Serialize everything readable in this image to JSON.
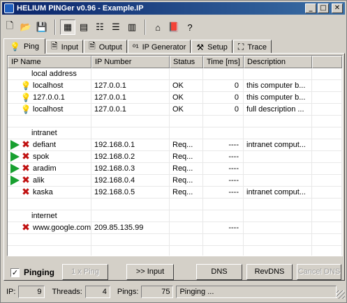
{
  "window": {
    "title": "HELIUM PINGer  v0.96  -  Example.IP",
    "controls": {
      "minimize": "_",
      "maximize": "□",
      "close": "✕"
    }
  },
  "toolbar": {
    "tools": [
      {
        "name": "new-file-icon",
        "glyph": "🗋"
      },
      {
        "name": "open-folder-icon",
        "glyph": "📂"
      },
      {
        "name": "save-icon",
        "glyph": "💾"
      },
      {
        "name": "large-icons-view-icon",
        "glyph": "▦"
      },
      {
        "name": "small-icons-view-icon",
        "glyph": "▤"
      },
      {
        "name": "list-view-icon",
        "glyph": "☷"
      },
      {
        "name": "details-view-icon",
        "glyph": "☰"
      },
      {
        "name": "grid-view-icon",
        "glyph": "▥"
      },
      {
        "name": "home-icon",
        "glyph": "⌂"
      },
      {
        "name": "book-icon",
        "glyph": "📕"
      },
      {
        "name": "help-icon",
        "glyph": "?"
      }
    ]
  },
  "tabs": [
    {
      "label": "Ping",
      "icon": "bulb-icon",
      "glyph": "💡",
      "active": true
    },
    {
      "label": "Input",
      "icon": "document-icon",
      "glyph": "🗎",
      "active": false
    },
    {
      "label": "Output",
      "icon": "document-icon",
      "glyph": "🗎",
      "active": false
    },
    {
      "label": "IP Generator",
      "icon": "binary-icon",
      "glyph": "⁰¹",
      "active": false
    },
    {
      "label": "Setup",
      "icon": "tools-icon",
      "glyph": "⚒",
      "active": false
    },
    {
      "label": "Trace",
      "icon": "trace-icon",
      "glyph": "⛶",
      "active": false
    }
  ],
  "table": {
    "columns": [
      "IP Name",
      "IP Number",
      "Status",
      "Time [ms]",
      "Description"
    ],
    "rows": [
      {
        "type": "group",
        "name": "local address"
      },
      {
        "type": "host",
        "icons": [
          "",
          "bulb"
        ],
        "name": "localhost",
        "ip": "127.0.0.1",
        "status": "OK",
        "time": "0",
        "desc": "this computer b..."
      },
      {
        "type": "host",
        "icons": [
          "",
          "bulb"
        ],
        "name": "127.0.0.1",
        "ip": "127.0.0.1",
        "status": "OK",
        "time": "0",
        "desc": "this computer b..."
      },
      {
        "type": "host",
        "icons": [
          "",
          "bulb"
        ],
        "name": "localhost",
        "ip": "127.0.0.1",
        "status": "OK",
        "time": "0",
        "desc": "full description ..."
      },
      {
        "type": "blank"
      },
      {
        "type": "group",
        "name": "intranet"
      },
      {
        "type": "host",
        "icons": [
          "arrow",
          "x"
        ],
        "name": "defiant",
        "ip": "192.168.0.1",
        "status": "Req...",
        "time": "----",
        "desc": " intranet comput..."
      },
      {
        "type": "host",
        "icons": [
          "arrow",
          "x"
        ],
        "name": "spok",
        "ip": "192.168.0.2",
        "status": "Req...",
        "time": "----",
        "desc": ""
      },
      {
        "type": "host",
        "icons": [
          "arrow",
          "x"
        ],
        "name": "aradim",
        "ip": "192.168.0.3",
        "status": "Req...",
        "time": "----",
        "desc": ""
      },
      {
        "type": "host",
        "icons": [
          "arrow",
          "x"
        ],
        "name": "alik",
        "ip": "192.168.0.4",
        "status": "Req...",
        "time": "----",
        "desc": ""
      },
      {
        "type": "host",
        "icons": [
          "",
          "x"
        ],
        "name": "kaska",
        "ip": "192.168.0.5",
        "status": "Req...",
        "time": "----",
        "desc": " intranet comput..."
      },
      {
        "type": "blank"
      },
      {
        "type": "group",
        "name": "internet"
      },
      {
        "type": "host",
        "icons": [
          "",
          "x"
        ],
        "name": "www.google.com",
        "ip": "209.85.135.99",
        "status": "",
        "time": "----",
        "desc": ""
      }
    ]
  },
  "controls": {
    "pinging_checked": true,
    "pinging_check_glyph": "✓",
    "pinging_label": "Pinging",
    "one_ping": "1 x Ping",
    "to_input": ">> Input",
    "dns": "DNS",
    "revdns": "RevDNS",
    "cancel_dns": "Cancel DNS"
  },
  "status": {
    "ip_label": "IP:",
    "ip_value": "9",
    "threads_label": "Threads:",
    "threads_value": "4",
    "pings_label": "Pings:",
    "pings_value": "75",
    "message": "Pinging ..."
  }
}
